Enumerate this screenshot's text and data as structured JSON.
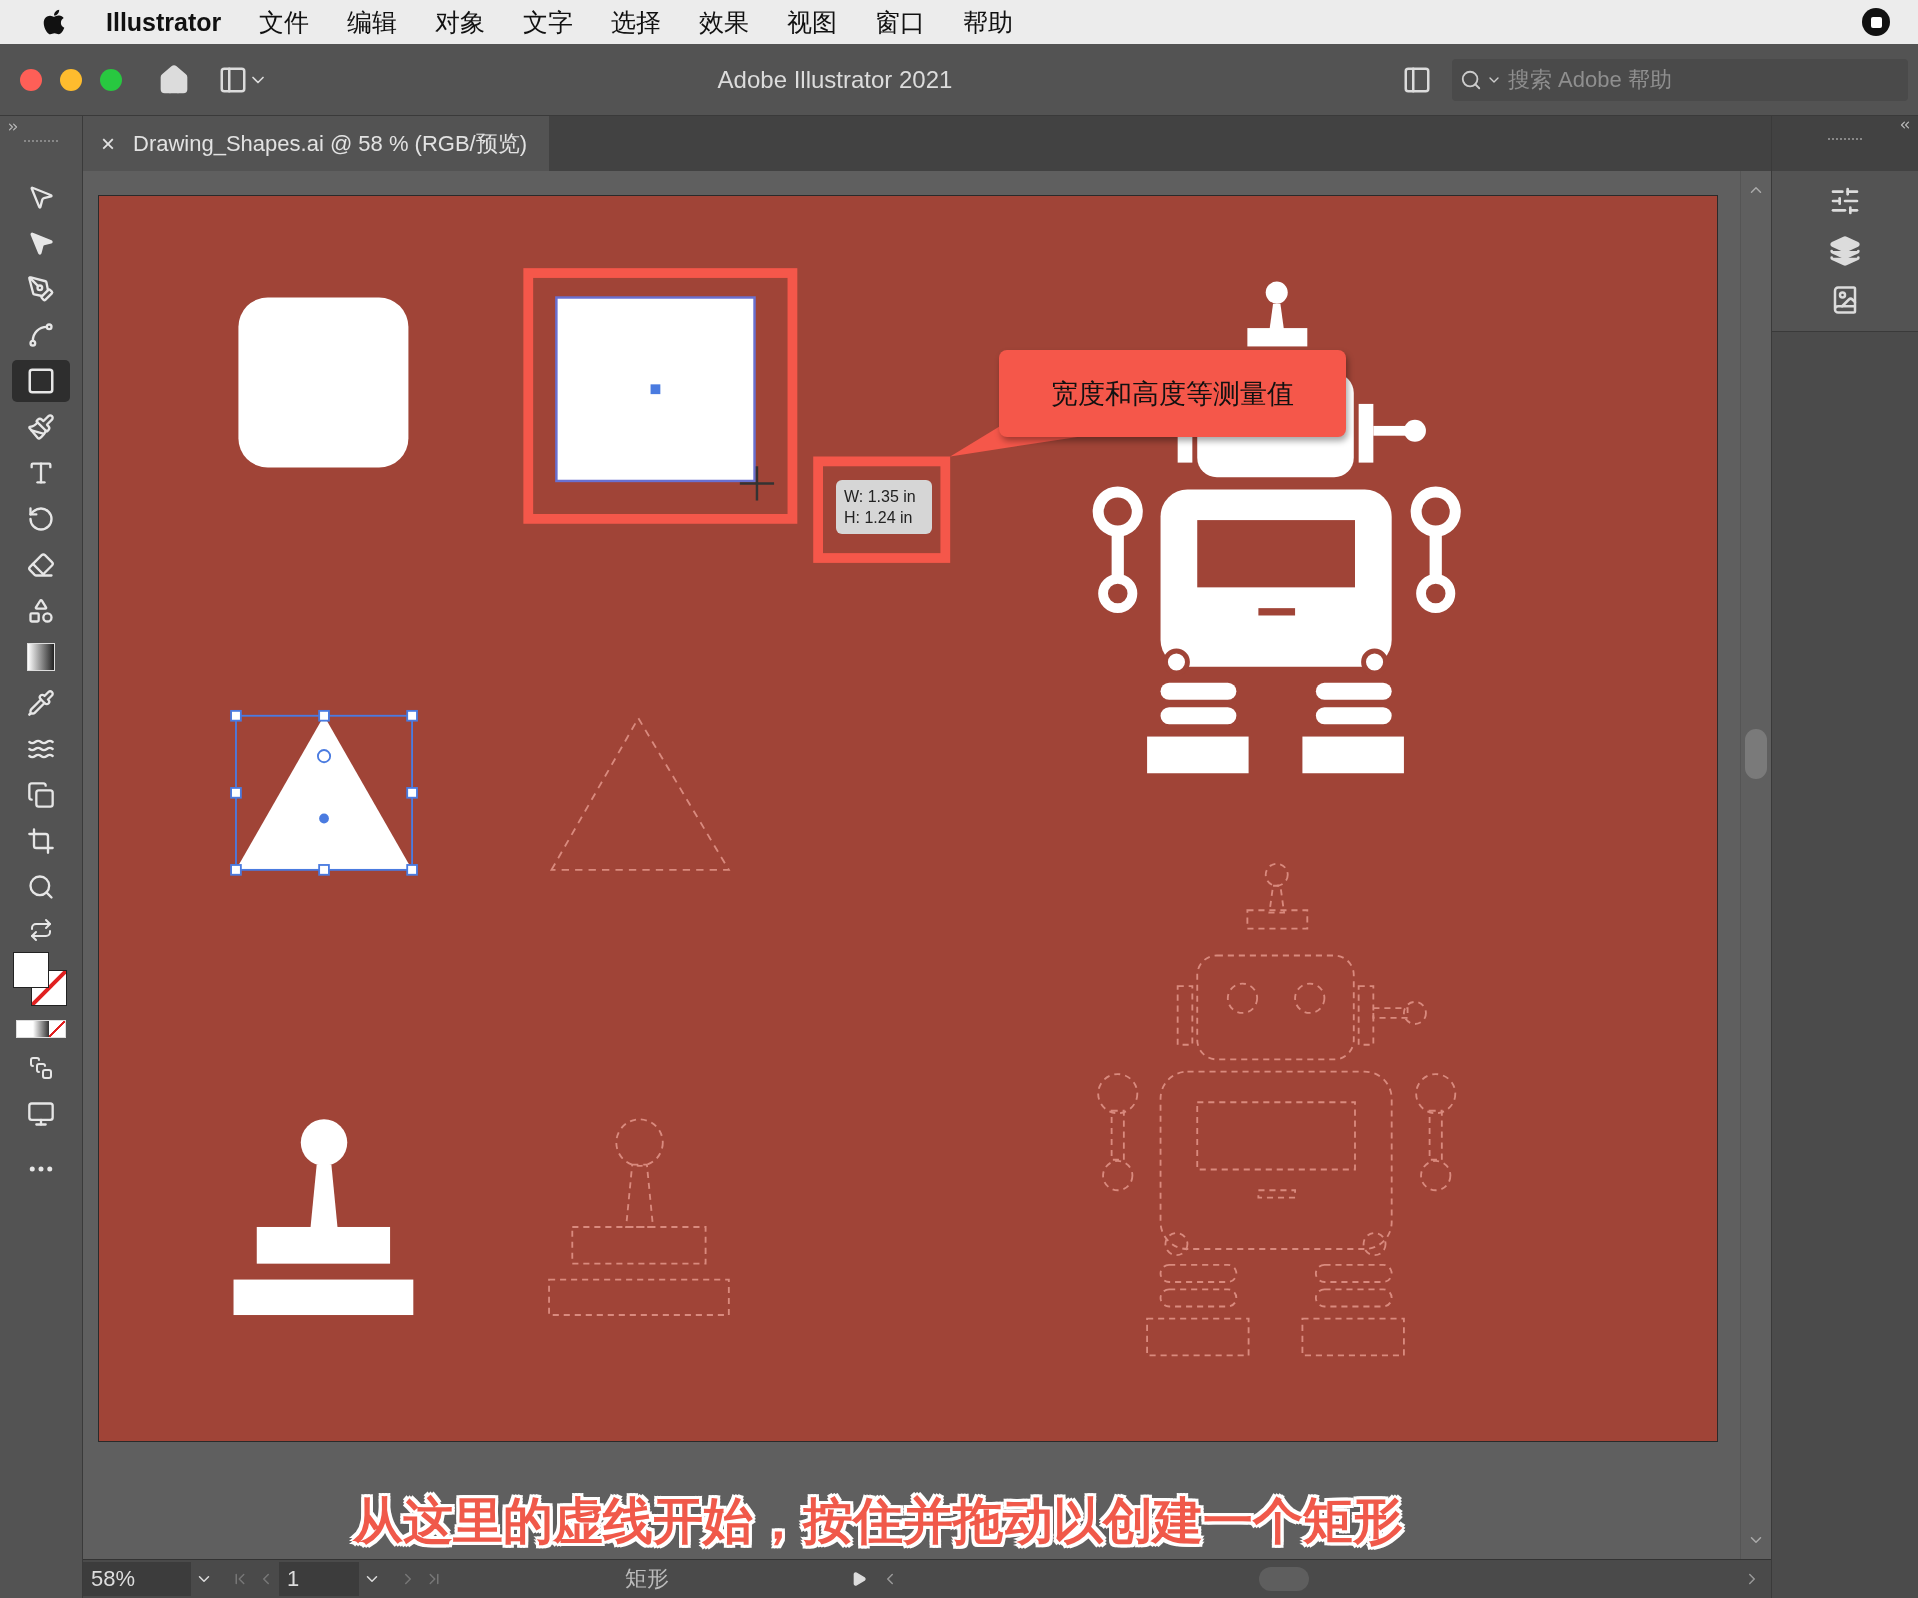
{
  "menu_bar": {
    "app": "Illustrator",
    "items": [
      "文件",
      "编辑",
      "对象",
      "文字",
      "选择",
      "效果",
      "视图",
      "窗口",
      "帮助"
    ]
  },
  "title_bar": {
    "title": "Adobe Illustrator 2021",
    "search": {
      "placeholder": "搜索 Adobe 帮助"
    }
  },
  "document_tab": {
    "close": "×",
    "title": "Drawing_Shapes.ai @ 58 % (RGB/预览)"
  },
  "tools": [
    {
      "selected": false
    },
    {
      "selected": false
    },
    {
      "selected": false
    },
    {
      "selected": false
    },
    {
      "selected": true
    },
    {
      "selected": false
    },
    {
      "selected": false
    },
    {
      "selected": false
    },
    {
      "selected": false
    },
    {
      "selected": false
    },
    {
      "selected": false
    },
    {
      "selected": false
    },
    {
      "selected": false
    },
    {
      "selected": false
    },
    {
      "selected": false
    },
    {
      "selected": false
    }
  ],
  "canvas": {
    "measurement": {
      "width": "W: 1.35 in",
      "height": "H: 1.24 in"
    },
    "callout": "宽度和高度等测量值",
    "caption": "从这里的虚线开始，按住并拖动以创建一个矩形"
  },
  "status_bar": {
    "zoom": "58%",
    "page": "1",
    "tool": "矩形"
  }
}
